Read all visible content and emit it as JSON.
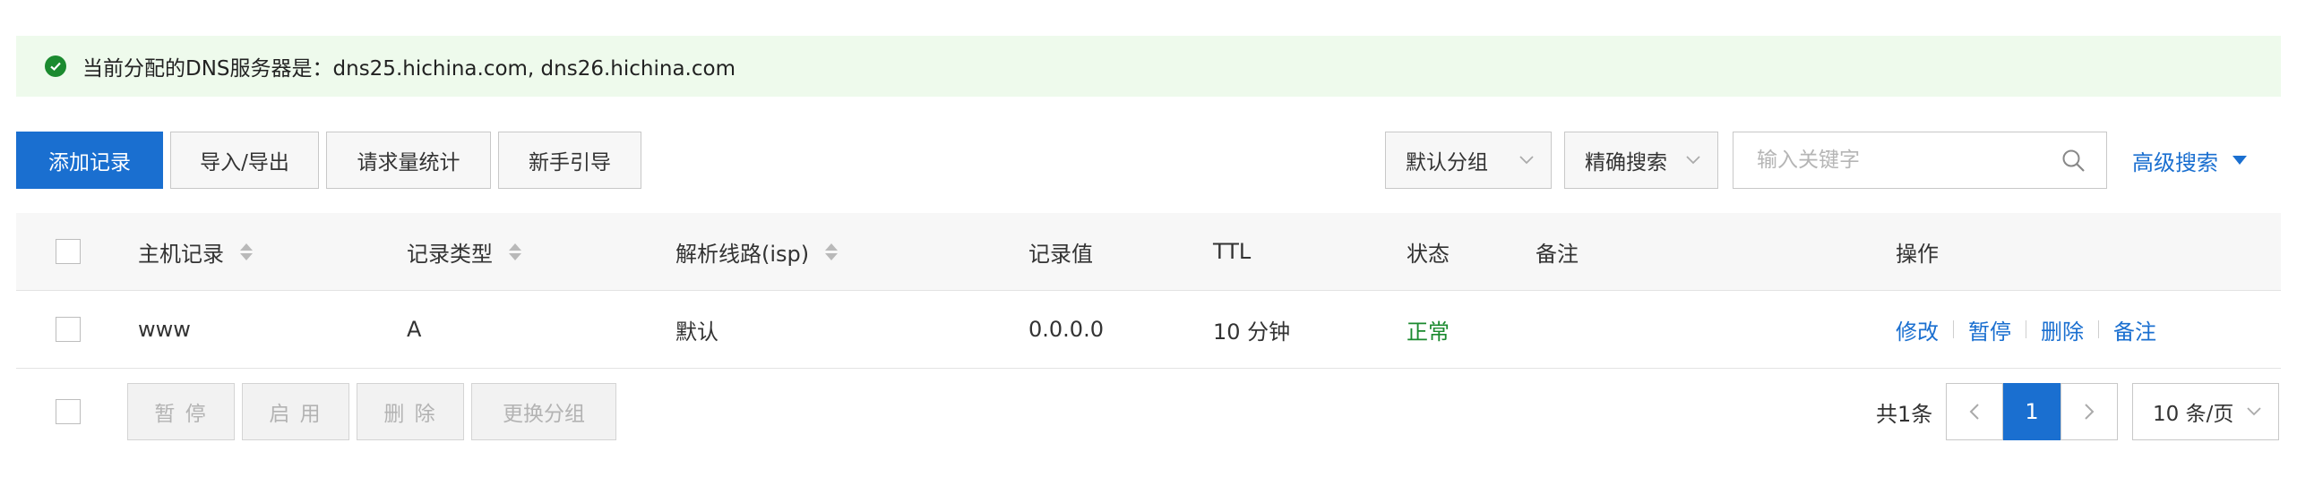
{
  "notice": {
    "text": "当前分配的DNS服务器是：dns25.hichina.com, dns26.hichina.com"
  },
  "toolbar": {
    "add_label": "添加记录",
    "import_label": "导入/导出",
    "stats_label": "请求量统计",
    "guide_label": "新手引导",
    "group_select_value": "默认分组",
    "search_mode_value": "精确搜索",
    "search_placeholder": "输入关键字",
    "advanced_label": "高级搜索"
  },
  "table": {
    "columns": [
      "主机记录",
      "记录类型",
      "解析线路(isp)",
      "记录值",
      "TTL",
      "状态",
      "备注",
      "操作"
    ],
    "rows": [
      {
        "host": "www",
        "type": "A",
        "line": "默认",
        "value": "0.0.0.0",
        "ttl": "10 分钟",
        "status": "正常",
        "remark": "",
        "actions": [
          "修改",
          "暂停",
          "删除",
          "备注"
        ]
      }
    ]
  },
  "footer": {
    "pause_label": "暂 停",
    "enable_label": "启 用",
    "delete_label": "删 除",
    "change_group_label": "更换分组",
    "total_text": "共1条",
    "current_page": "1",
    "page_size_value": "10 条/页"
  },
  "colors": {
    "primary": "#1a6fd0",
    "success": "#1b8a2f",
    "notice_bg": "#eefaec"
  },
  "icons": {
    "notice": "check-circle-icon",
    "search": "search-icon",
    "dropdown": "chevron-down-icon",
    "advanced": "caret-down-icon",
    "sort": "sort-icon",
    "prev": "chevron-left-icon",
    "next": "chevron-right-icon"
  }
}
